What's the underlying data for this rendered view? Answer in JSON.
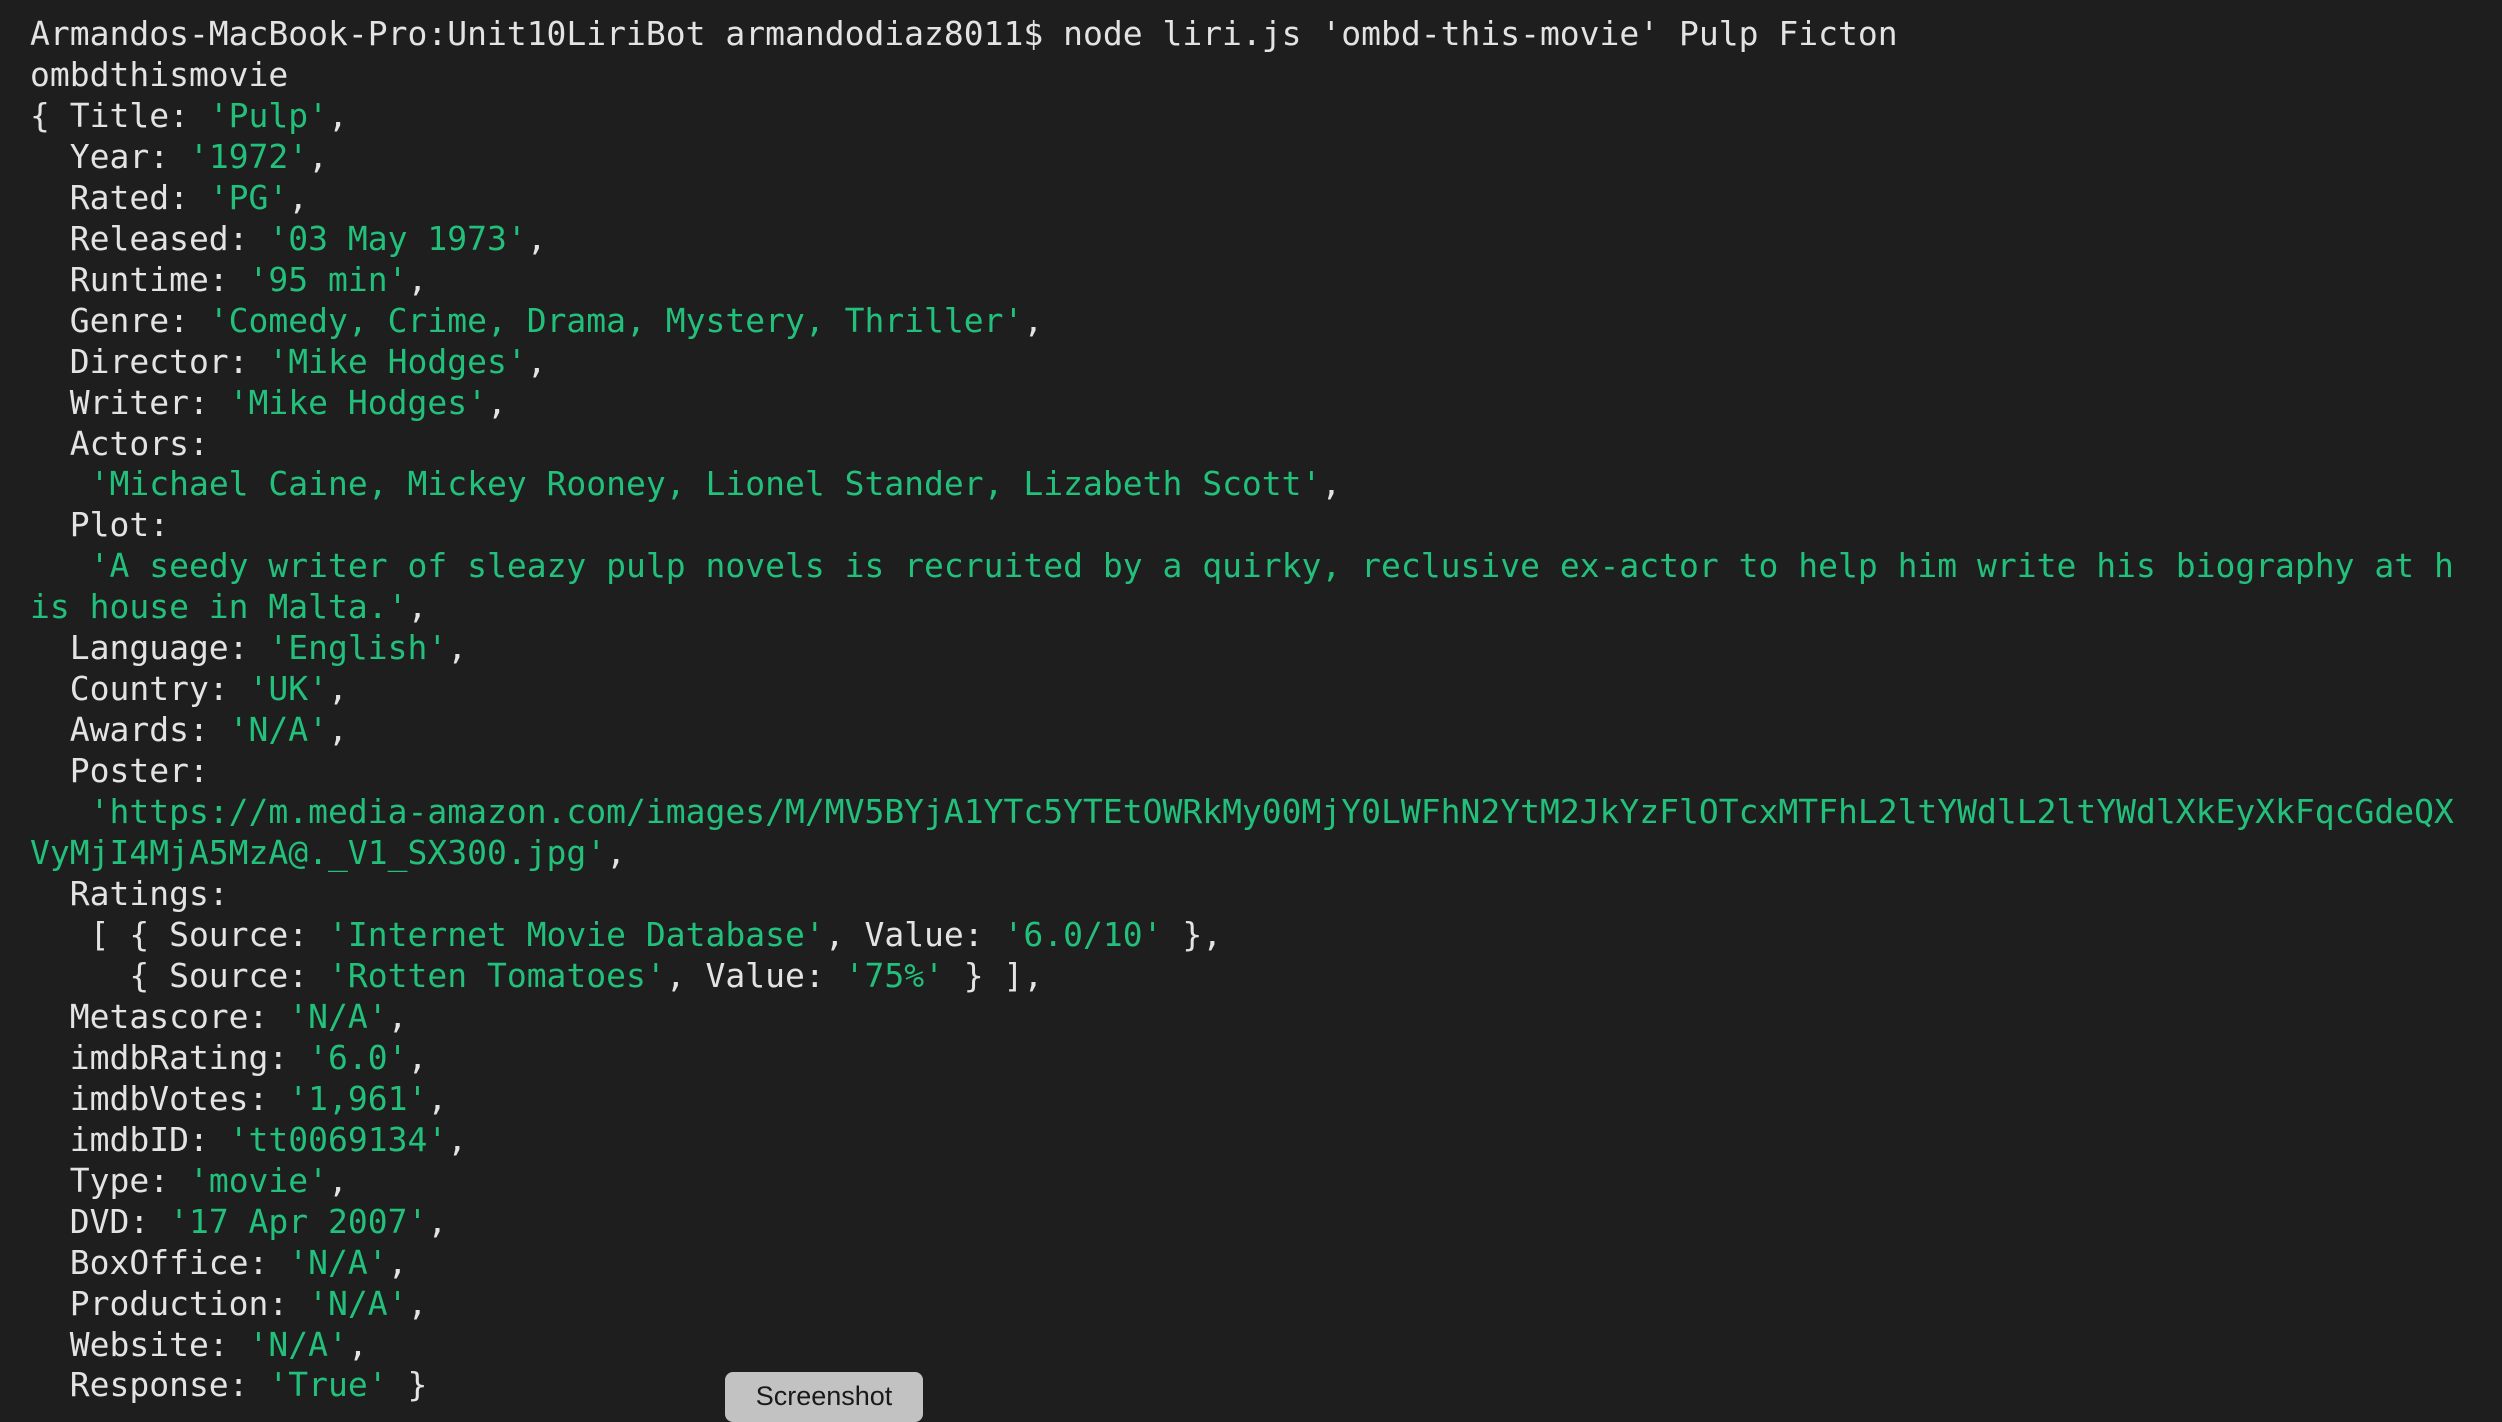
{
  "colors": {
    "background": "#1e1e1e",
    "text": "#e3e3e3",
    "string": "#22c07b"
  },
  "terminal": {
    "lines": [
      [
        [
          "p",
          "Armandos-MacBook-Pro:Unit10LiriBot armandodiaz8011$ node liri.js 'ombd-this-movie' Pulp Ficton"
        ]
      ],
      [
        [
          "p",
          "ombdthismovie"
        ]
      ],
      [
        [
          "p",
          "{ Title: "
        ],
        [
          "s",
          "'Pulp'"
        ],
        [
          "p",
          ","
        ]
      ],
      [
        [
          "p",
          "  Year: "
        ],
        [
          "s",
          "'1972'"
        ],
        [
          "p",
          ","
        ]
      ],
      [
        [
          "p",
          "  Rated: "
        ],
        [
          "s",
          "'PG'"
        ],
        [
          "p",
          ","
        ]
      ],
      [
        [
          "p",
          "  Released: "
        ],
        [
          "s",
          "'03 May 1973'"
        ],
        [
          "p",
          ","
        ]
      ],
      [
        [
          "p",
          "  Runtime: "
        ],
        [
          "s",
          "'95 min'"
        ],
        [
          "p",
          ","
        ]
      ],
      [
        [
          "p",
          "  Genre: "
        ],
        [
          "s",
          "'Comedy, Crime, Drama, Mystery, Thriller'"
        ],
        [
          "p",
          ","
        ]
      ],
      [
        [
          "p",
          "  Director: "
        ],
        [
          "s",
          "'Mike Hodges'"
        ],
        [
          "p",
          ","
        ]
      ],
      [
        [
          "p",
          "  Writer: "
        ],
        [
          "s",
          "'Mike Hodges'"
        ],
        [
          "p",
          ","
        ]
      ],
      [
        [
          "p",
          "  Actors:"
        ]
      ],
      [
        [
          "p",
          "   "
        ],
        [
          "s",
          "'Michael Caine, Mickey Rooney, Lionel Stander, Lizabeth Scott'"
        ],
        [
          "p",
          ","
        ]
      ],
      [
        [
          "p",
          "  Plot:"
        ]
      ],
      [
        [
          "p",
          "   "
        ],
        [
          "s",
          "'A seedy writer of sleazy pulp novels is recruited by a quirky, reclusive ex-actor to help him write his biography at h"
        ]
      ],
      [
        [
          "s",
          "is house in Malta.'"
        ],
        [
          "p",
          ","
        ]
      ],
      [
        [
          "p",
          "  Language: "
        ],
        [
          "s",
          "'English'"
        ],
        [
          "p",
          ","
        ]
      ],
      [
        [
          "p",
          "  Country: "
        ],
        [
          "s",
          "'UK'"
        ],
        [
          "p",
          ","
        ]
      ],
      [
        [
          "p",
          "  Awards: "
        ],
        [
          "s",
          "'N/A'"
        ],
        [
          "p",
          ","
        ]
      ],
      [
        [
          "p",
          "  Poster:"
        ]
      ],
      [
        [
          "p",
          "   "
        ],
        [
          "s",
          "'https://m.media-amazon.com/images/M/MV5BYjA1YTc5YTEtOWRkMy00MjY0LWFhN2YtM2JkYzFlOTcxMTFhL2ltYWdlL2ltYWdlXkEyXkFqcGdeQX"
        ]
      ],
      [
        [
          "s",
          "VyMjI4MjA5MzA@._V1_SX300.jpg'"
        ],
        [
          "p",
          ","
        ]
      ],
      [
        [
          "p",
          "  Ratings:"
        ]
      ],
      [
        [
          "p",
          "   [ { Source: "
        ],
        [
          "s",
          "'Internet Movie Database'"
        ],
        [
          "p",
          ", Value: "
        ],
        [
          "s",
          "'6.0/10'"
        ],
        [
          "p",
          " },"
        ]
      ],
      [
        [
          "p",
          "     { Source: "
        ],
        [
          "s",
          "'Rotten Tomatoes'"
        ],
        [
          "p",
          ", Value: "
        ],
        [
          "s",
          "'75%'"
        ],
        [
          "p",
          " } ],"
        ]
      ],
      [
        [
          "p",
          "  Metascore: "
        ],
        [
          "s",
          "'N/A'"
        ],
        [
          "p",
          ","
        ]
      ],
      [
        [
          "p",
          "  imdbRating: "
        ],
        [
          "s",
          "'6.0'"
        ],
        [
          "p",
          ","
        ]
      ],
      [
        [
          "p",
          "  imdbVotes: "
        ],
        [
          "s",
          "'1,961'"
        ],
        [
          "p",
          ","
        ]
      ],
      [
        [
          "p",
          "  imdbID: "
        ],
        [
          "s",
          "'tt0069134'"
        ],
        [
          "p",
          ","
        ]
      ],
      [
        [
          "p",
          "  Type: "
        ],
        [
          "s",
          "'movie'"
        ],
        [
          "p",
          ","
        ]
      ],
      [
        [
          "p",
          "  DVD: "
        ],
        [
          "s",
          "'17 Apr 2007'"
        ],
        [
          "p",
          ","
        ]
      ],
      [
        [
          "p",
          "  BoxOffice: "
        ],
        [
          "s",
          "'N/A'"
        ],
        [
          "p",
          ","
        ]
      ],
      [
        [
          "p",
          "  Production: "
        ],
        [
          "s",
          "'N/A'"
        ],
        [
          "p",
          ","
        ]
      ],
      [
        [
          "p",
          "  Website: "
        ],
        [
          "s",
          "'N/A'"
        ],
        [
          "p",
          ","
        ]
      ],
      [
        [
          "p",
          "  Response: "
        ],
        [
          "s",
          "'True'"
        ],
        [
          "p",
          " }"
        ]
      ]
    ]
  },
  "screenshot_button": {
    "label": "Screenshot"
  }
}
